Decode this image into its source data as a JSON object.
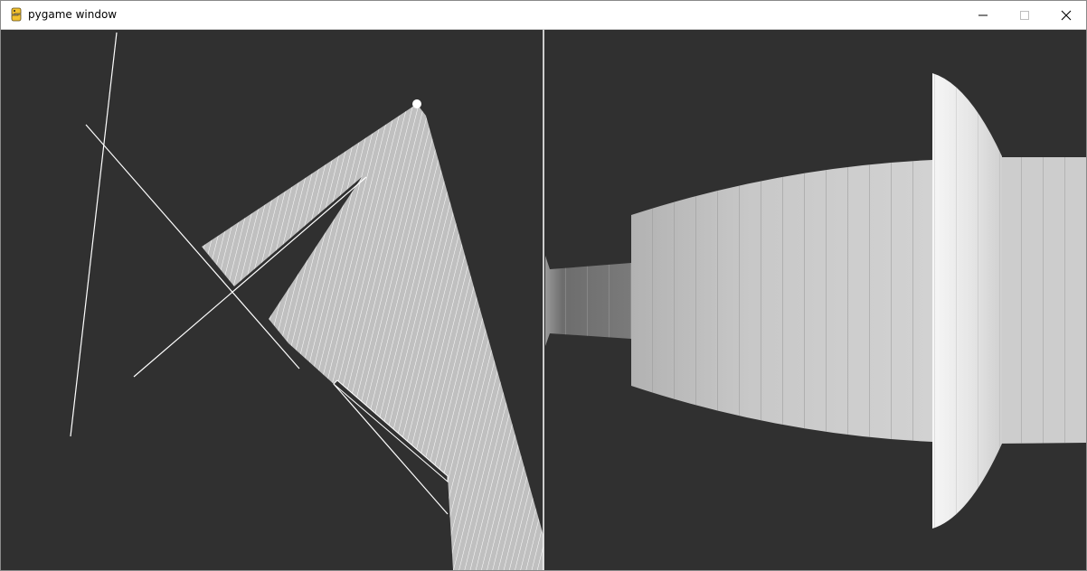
{
  "window": {
    "title": "pygame window",
    "icon": "pygame-snake-icon",
    "controls": [
      "minimize-icon",
      "maximize-icon",
      "close-icon"
    ]
  },
  "colors": {
    "background": "#303030",
    "light_cone": "#c0c0c0",
    "walls": "#ffffff",
    "wall_shade_far": "#5a5a5a",
    "wall_shade_mid": "#cfcfcf",
    "wall_shade_near": "#f2f2f2"
  },
  "views": {
    "left": "top-down-raycast-map",
    "right": "first-person-projection"
  }
}
